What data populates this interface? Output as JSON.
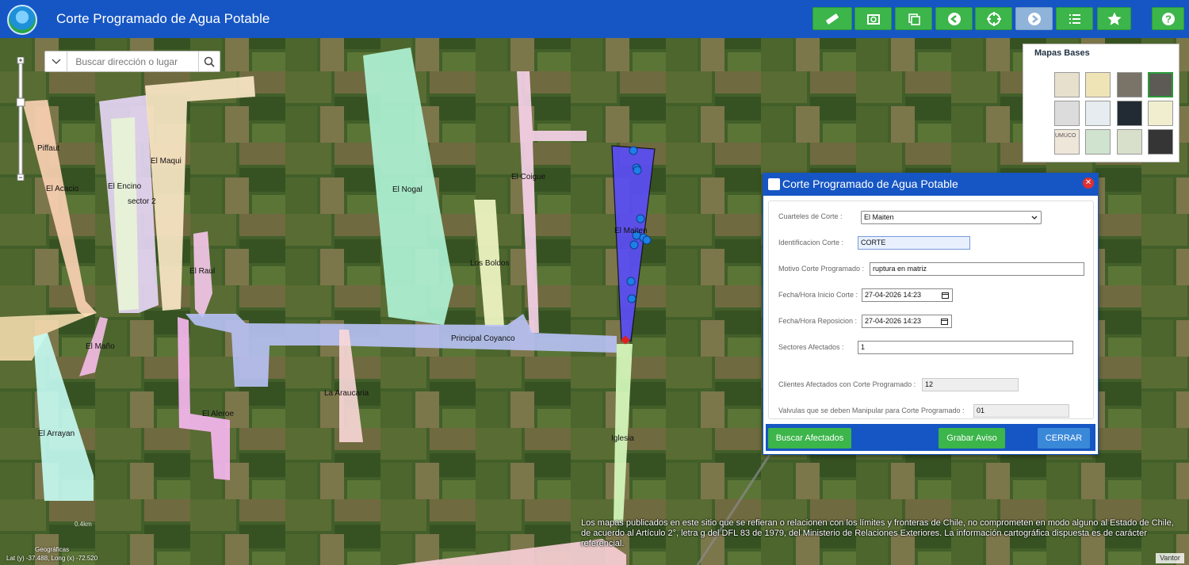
{
  "header": {
    "title": "Corte Programado de Agua Potable",
    "tools": [
      "ruler-icon",
      "photo-search-icon",
      "layers-copy-icon",
      "back-arrow-icon",
      "locate-target-icon",
      "forward-arrow-icon",
      "list-icon",
      "favorite-star-icon",
      "help-icon"
    ]
  },
  "search": {
    "placeholder": "Buscar dirección o lugar"
  },
  "basemaps": {
    "title": "Mapas Bases",
    "thumb_label": "UMUCO"
  },
  "zones": [
    "Piffaut",
    "El Acacio",
    "El Encino",
    "sector 2",
    "El Maqui",
    "El Nogal",
    "El Coigue",
    "El Maiten",
    "Los Boldos",
    "El Raul",
    "Principal Coyanco",
    "El Maño",
    "La Araucaria",
    "El Aleroe",
    "El Arrayan",
    "Iglesia"
  ],
  "dialog": {
    "title": "Corte Programado de Agua Potable",
    "close_label": "✕",
    "fields": {
      "cuarteles_label": "Cuarteles de Corte :",
      "cuarteles_value": "El Maiten",
      "identificacion_label": "Identificacion Corte :",
      "identificacion_value": "CORTE",
      "motivo_label": "Motivo Corte Programado :",
      "motivo_value": "ruptura en matriz",
      "inicio_label": "Fecha/Hora Inicio Corte :",
      "inicio_value": "27-04-2026 14:23",
      "reposicion_label": "Fecha/Hora Reposicion :",
      "reposicion_value": "27-04-2026 14:23",
      "sectores_label": "Sectores Afectados :",
      "sectores_value": "1",
      "clientes_label": "Clientes Afectados con Corte Programado :",
      "clientes_value": "12",
      "valvulas_label": "Valvulas que se deben Manipular para Corte Programado :",
      "valvulas_value": "01"
    },
    "buttons": {
      "buscar": "Buscar Afectados",
      "grabar": "Grabar Aviso",
      "cerrar": "CERRAR"
    }
  },
  "footer": {
    "disclaimer": "Los mapas publicados en este sitio que se refieran o relacionen con los límites y fronteras de Chile, no comprometen en modo alguno al Estado de Chile, de acuerdo al Artículo 2°, letra g del DFL 83 de 1979, del Ministerio de Relaciones Exteriores. La información cartográfica dispuesta es de carácter referencial.",
    "coords_title": "Geográficas",
    "coords": "Lat (y) -37.488, Long (x) -72.520",
    "scale": "0.4km",
    "attribution": "Vantor"
  },
  "colors": {
    "header": "#1656c4",
    "tool_button": "#3cb54a",
    "cerrar_button": "#3a88d8",
    "selected_zone": "#5a4ef0"
  }
}
